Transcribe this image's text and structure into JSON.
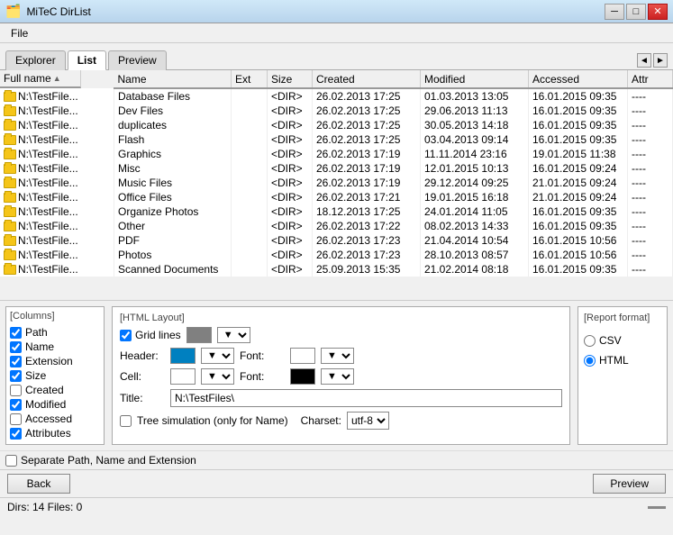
{
  "window": {
    "title": "MiTeC DirList",
    "icon": "📁"
  },
  "menu": {
    "items": [
      "File"
    ]
  },
  "tabs": {
    "items": [
      "Explorer",
      "List",
      "Preview"
    ],
    "active": "List"
  },
  "table": {
    "columns": [
      "Full name",
      "Name",
      "Ext",
      "Size",
      "Created",
      "Modified",
      "Accessed",
      "Attr"
    ],
    "sort_col": "Full name",
    "sort_dir": "asc",
    "rows": [
      {
        "fullname": "N:\\TestFile...",
        "name": "Database Files",
        "ext": "",
        "size": "<DIR>",
        "created": "26.02.2013 17:25",
        "modified": "01.03.2013 13:05",
        "accessed": "16.01.2015 09:35",
        "attr": "----"
      },
      {
        "fullname": "N:\\TestFile...",
        "name": "Dev Files",
        "ext": "",
        "size": "<DIR>",
        "created": "26.02.2013 17:25",
        "modified": "29.06.2013 11:13",
        "accessed": "16.01.2015 09:35",
        "attr": "----"
      },
      {
        "fullname": "N:\\TestFile...",
        "name": "duplicates",
        "ext": "",
        "size": "<DIR>",
        "created": "26.02.2013 17:25",
        "modified": "30.05.2013 14:18",
        "accessed": "16.01.2015 09:35",
        "attr": "----"
      },
      {
        "fullname": "N:\\TestFile...",
        "name": "Flash",
        "ext": "",
        "size": "<DIR>",
        "created": "26.02.2013 17:25",
        "modified": "03.04.2013 09:14",
        "accessed": "16.01.2015 09:35",
        "attr": "----"
      },
      {
        "fullname": "N:\\TestFile...",
        "name": "Graphics",
        "ext": "",
        "size": "<DIR>",
        "created": "26.02.2013 17:19",
        "modified": "11.11.2014 23:16",
        "accessed": "19.01.2015 11:38",
        "attr": "----"
      },
      {
        "fullname": "N:\\TestFile...",
        "name": "Misc",
        "ext": "",
        "size": "<DIR>",
        "created": "26.02.2013 17:19",
        "modified": "12.01.2015 10:13",
        "accessed": "16.01.2015 09:24",
        "attr": "----"
      },
      {
        "fullname": "N:\\TestFile...",
        "name": "Music Files",
        "ext": "",
        "size": "<DIR>",
        "created": "26.02.2013 17:19",
        "modified": "29.12.2014 09:25",
        "accessed": "21.01.2015 09:24",
        "attr": "----"
      },
      {
        "fullname": "N:\\TestFile...",
        "name": "Office Files",
        "ext": "",
        "size": "<DIR>",
        "created": "26.02.2013 17:21",
        "modified": "19.01.2015 16:18",
        "accessed": "21.01.2015 09:24",
        "attr": "----"
      },
      {
        "fullname": "N:\\TestFile...",
        "name": "Organize Photos",
        "ext": "",
        "size": "<DIR>",
        "created": "18.12.2013 17:25",
        "modified": "24.01.2014 11:05",
        "accessed": "16.01.2015 09:35",
        "attr": "----"
      },
      {
        "fullname": "N:\\TestFile...",
        "name": "Other",
        "ext": "",
        "size": "<DIR>",
        "created": "26.02.2013 17:22",
        "modified": "08.02.2013 14:33",
        "accessed": "16.01.2015 09:35",
        "attr": "----"
      },
      {
        "fullname": "N:\\TestFile...",
        "name": "PDF",
        "ext": "",
        "size": "<DIR>",
        "created": "26.02.2013 17:23",
        "modified": "21.04.2014 10:54",
        "accessed": "16.01.2015 10:56",
        "attr": "----"
      },
      {
        "fullname": "N:\\TestFile...",
        "name": "Photos",
        "ext": "",
        "size": "<DIR>",
        "created": "26.02.2013 17:23",
        "modified": "28.10.2013 08:57",
        "accessed": "16.01.2015 10:56",
        "attr": "----"
      },
      {
        "fullname": "N:\\TestFile...",
        "name": "Scanned Documents",
        "ext": "",
        "size": "<DIR>",
        "created": "25.09.2013 15:35",
        "modified": "21.02.2014 08:18",
        "accessed": "16.01.2015 09:35",
        "attr": "----"
      }
    ]
  },
  "columns_panel": {
    "title": "[Columns]",
    "items": [
      {
        "label": "Path",
        "checked": true
      },
      {
        "label": "Name",
        "checked": true
      },
      {
        "label": "Extension",
        "checked": true
      },
      {
        "label": "Size",
        "checked": true
      },
      {
        "label": "Created",
        "checked": false
      },
      {
        "label": "Modified",
        "checked": true
      },
      {
        "label": "Accessed",
        "checked": false
      },
      {
        "label": "Attributes",
        "checked": true
      }
    ]
  },
  "html_layout": {
    "title": "[HTML Layout]",
    "gridlines_label": "Grid lines",
    "gridlines_color": "#808080",
    "header_label": "Header:",
    "header_color": "#0080C0",
    "header_font_label": "Font:",
    "header_font_color": "#FFFFFF",
    "cell_label": "Cell:",
    "cell_color": "#FFFFFF",
    "cell_font_label": "Font:",
    "cell_font_color": "#000000",
    "title_label": "Title:",
    "title_value": "N:\\TestFiles\\",
    "tree_sim_label": "Tree simulation (only for Name)",
    "charset_label": "Charset:",
    "charset_value": "utf-8"
  },
  "report_format": {
    "title": "[Report format]",
    "options": [
      "CSV",
      "HTML"
    ],
    "selected": "HTML"
  },
  "separate_path": {
    "label": "Separate Path, Name and Extension",
    "checked": false
  },
  "actions": {
    "back_label": "Back",
    "preview_label": "Preview"
  },
  "status": {
    "text": "Dirs: 14   Files: 0"
  }
}
